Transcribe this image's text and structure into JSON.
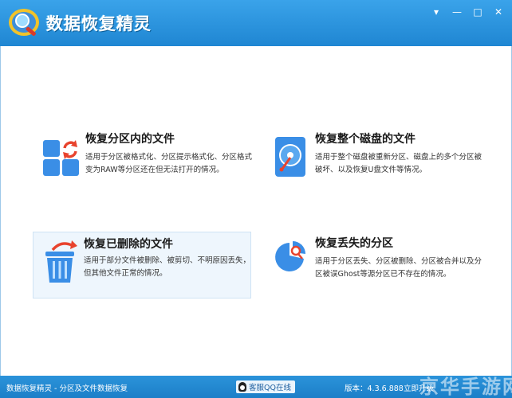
{
  "window": {
    "title": "数据恢复精灵",
    "controls": {
      "menu": "▾",
      "minimize": "—",
      "maximize": "□",
      "close": "✕"
    }
  },
  "cards": [
    {
      "title": "恢复分区内的文件",
      "desc": "适用于分区被格式化、分区提示格式化、分区格式变为RAW等分区还在但无法打开的情况。",
      "icon": "partition-recover-icon"
    },
    {
      "title": "恢复整个磁盘的文件",
      "desc": "适用于整个磁盘被重新分区、磁盘上的多个分区被破坏、以及恢复U盘文件等情况。",
      "icon": "disk-icon"
    },
    {
      "title": "恢复已删除的文件",
      "desc": "适用于部分文件被删除、被剪切、不明原因丢失，但其他文件正常的情况。",
      "icon": "recycle-bin-icon"
    },
    {
      "title": "恢复丢失的分区",
      "desc": "适用于分区丢失、分区被删除、分区被合并以及分区被误Ghost等源分区已不存在的情况。",
      "icon": "pie-search-icon"
    }
  ],
  "status": {
    "left": "数据恢复精灵 - 分区及文件数据恢复",
    "qq": "客服QQ在线",
    "version": "版本：4.3.6.888",
    "upgrade": "立即升级"
  },
  "watermark": "京华手游网",
  "colors": {
    "accent": "#1f86d2",
    "icon_blue": "#3a8ee6",
    "icon_red": "#e8432d"
  }
}
